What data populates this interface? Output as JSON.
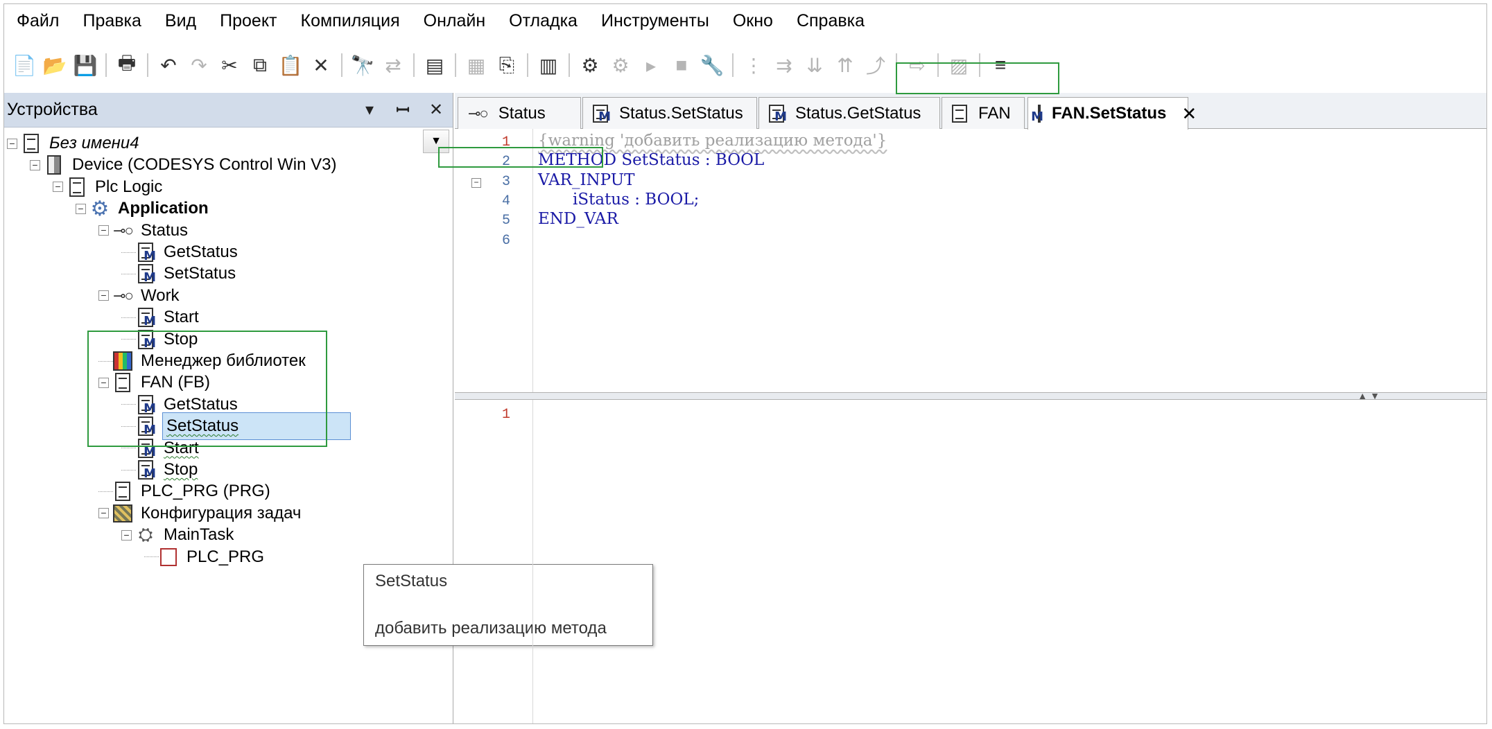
{
  "menu": [
    "Файл",
    "Правка",
    "Вид",
    "Проект",
    "Компиляция",
    "Онлайн",
    "Отладка",
    "Инструменты",
    "Окно",
    "Справка"
  ],
  "toolbar": {
    "buttons": [
      {
        "icon": "new-project-icon",
        "glyph": "📄",
        "enabled": true
      },
      {
        "icon": "open-project-icon",
        "glyph": "📂",
        "enabled": true
      },
      {
        "icon": "save-icon",
        "glyph": "💾",
        "enabled": true
      },
      {
        "sep": true
      },
      {
        "icon": "print-icon",
        "glyph": "🖶",
        "enabled": true
      },
      {
        "sep": true
      },
      {
        "icon": "undo-icon",
        "glyph": "↶",
        "enabled": true
      },
      {
        "icon": "redo-icon",
        "glyph": "↷",
        "enabled": false
      },
      {
        "icon": "cut-icon",
        "glyph": "✂",
        "enabled": true
      },
      {
        "icon": "copy-icon",
        "glyph": "⧉",
        "enabled": true
      },
      {
        "icon": "paste-icon",
        "glyph": "📋",
        "enabled": false
      },
      {
        "icon": "delete-icon",
        "glyph": "✕",
        "enabled": true
      },
      {
        "sep": true
      },
      {
        "icon": "find-icon",
        "glyph": "🔭",
        "enabled": true
      },
      {
        "icon": "replace-icon",
        "glyph": "⇄",
        "enabled": false
      },
      {
        "sep": true
      },
      {
        "icon": "select-all-icon",
        "glyph": "▤",
        "enabled": true
      },
      {
        "sep": true
      },
      {
        "icon": "add-object-icon",
        "glyph": "▦",
        "enabled": false
      },
      {
        "icon": "insert-icon",
        "glyph": "⎘",
        "enabled": true
      },
      {
        "sep": true
      },
      {
        "icon": "build-icon",
        "glyph": "▥",
        "enabled": true
      },
      {
        "sep": true
      },
      {
        "icon": "login-icon",
        "glyph": "⚙",
        "enabled": true
      },
      {
        "icon": "logout-icon",
        "glyph": "⚙",
        "enabled": false
      },
      {
        "icon": "start-icon",
        "glyph": "▸",
        "enabled": false
      },
      {
        "icon": "stop-icon",
        "glyph": "■",
        "enabled": false
      },
      {
        "icon": "reset-icon",
        "glyph": "🔧",
        "enabled": true
      },
      {
        "sep": true
      },
      {
        "icon": "breakpoint-icon",
        "glyph": "⋮",
        "enabled": false
      },
      {
        "icon": "step-over-icon",
        "glyph": "⇉",
        "enabled": false
      },
      {
        "icon": "step-into-icon",
        "glyph": "⇊",
        "enabled": false
      },
      {
        "icon": "step-out-icon",
        "glyph": "⇈",
        "enabled": false
      },
      {
        "icon": "run-to-cursor-icon",
        "glyph": "⤴",
        "enabled": false
      },
      {
        "sep": true
      },
      {
        "icon": "show-next-icon",
        "glyph": "⇨",
        "enabled": false
      },
      {
        "sep": true
      },
      {
        "icon": "force-values-icon",
        "glyph": "▨",
        "enabled": false
      },
      {
        "sep": true
      },
      {
        "icon": "write-values-icon",
        "glyph": "≡",
        "enabled": true
      }
    ]
  },
  "devices_panel": {
    "title": "Устройства",
    "tree": [
      {
        "name": "project-root",
        "label": "Без имени4",
        "icon": "project-icon",
        "italic": true,
        "expander": "−"
      },
      {
        "name": "device",
        "label": "Device (CODESYS Control Win V3)",
        "icon": "device-icon",
        "expander": "−"
      },
      {
        "name": "plc-logic",
        "label": "Plc Logic",
        "icon": "plc-logic-icon",
        "expander": "−"
      },
      {
        "name": "application",
        "label": "Application",
        "icon": "gear-icon",
        "bold": true,
        "expander": "−"
      },
      {
        "name": "interface-status",
        "label": "Status",
        "icon": "interface-icon",
        "expander": "−"
      },
      {
        "name": "status-getstatus",
        "label": "GetStatus",
        "icon": "method-prototype-icon"
      },
      {
        "name": "status-setstatus",
        "label": "SetStatus",
        "icon": "method-prototype-icon"
      },
      {
        "name": "interface-work",
        "label": "Work",
        "icon": "interface-icon",
        "expander": "−"
      },
      {
        "name": "work-start",
        "label": "Start",
        "icon": "method-prototype-icon"
      },
      {
        "name": "work-stop",
        "label": "Stop",
        "icon": "method-prototype-icon"
      },
      {
        "name": "library-manager",
        "label": "Менеджер библиотек",
        "icon": "library-icon"
      },
      {
        "name": "fan-fb",
        "label": "FAN (FB)",
        "icon": "pou-icon",
        "expander": "−"
      },
      {
        "name": "fan-getstatus",
        "label": "GetStatus",
        "icon": "method-icon",
        "wavy": true
      },
      {
        "name": "fan-setstatus",
        "label": "SetStatus",
        "icon": "method-icon",
        "wavy": true,
        "selected": true
      },
      {
        "name": "fan-start",
        "label": "Start",
        "icon": "method-icon",
        "wavy": true
      },
      {
        "name": "fan-stop",
        "label": "Stop",
        "icon": "method-icon",
        "wavy": true
      },
      {
        "name": "plc-prg",
        "label": "PLC_PRG (PRG)",
        "icon": "pou-icon"
      },
      {
        "name": "task-config",
        "label": "Конфигурация задач",
        "icon": "task-config-icon",
        "expander": "−"
      },
      {
        "name": "main-task",
        "label": "MainTask",
        "icon": "task-icon",
        "expander": "−"
      },
      {
        "name": "task-plc-prg",
        "label": "PLC_PRG",
        "icon": "program-call-icon"
      }
    ]
  },
  "tooltip": {
    "title": "SetStatus",
    "body": "добавить реализацию метода"
  },
  "tabs": [
    {
      "label": "Status",
      "icon": "interface-icon",
      "active": false
    },
    {
      "label": "Status.SetStatus",
      "icon": "method-prototype-icon",
      "active": false
    },
    {
      "label": "Status.GetStatus",
      "icon": "method-prototype-icon",
      "active": false
    },
    {
      "label": "FAN",
      "icon": "pou-icon",
      "active": false
    },
    {
      "label": "FAN.SetStatus",
      "icon": "method-icon",
      "active": true,
      "close": "✕"
    }
  ],
  "declaration": [
    {
      "n": "1",
      "text": "{warning 'добавить реализацию метода'}",
      "type": "pragma",
      "err": true
    },
    {
      "n": "2",
      "text": "METHOD SetStatus : BOOL",
      "type": "code"
    },
    {
      "n": "3",
      "text": "VAR_INPUT",
      "type": "code",
      "fold": "−"
    },
    {
      "n": "4",
      "text": "iStatus : BOOL;",
      "type": "code",
      "indent": true
    },
    {
      "n": "5",
      "text": "END_VAR",
      "type": "code"
    },
    {
      "n": "6",
      "text": "",
      "type": "code"
    }
  ],
  "implementation": [
    {
      "n": "1",
      "text": "",
      "err": true
    }
  ],
  "colors": {
    "highlight_box": "#2e9a3e",
    "keyword": "#1a1aa6",
    "line_number": "#4a6fa5",
    "error_line_number": "#c0392b"
  }
}
